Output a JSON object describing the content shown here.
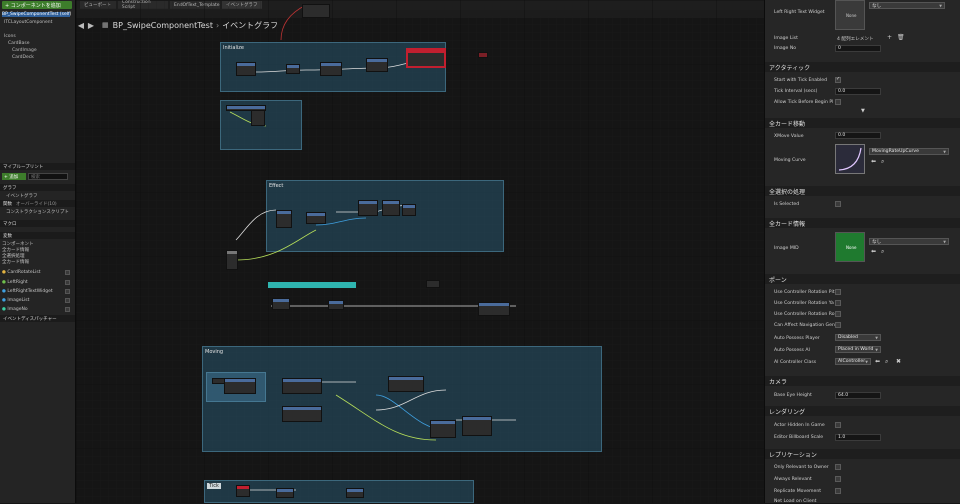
{
  "left_panel": {
    "add_component_button": "+ コンポーネントを追加",
    "components": [
      {
        "label": "BP_SwipeComponentTest (self)",
        "selected": true
      },
      {
        "label": "ITCLayoutComponent",
        "selected": false
      },
      {
        "label": "Icons",
        "selected": false
      },
      {
        "label": "CardBase",
        "selected": false
      },
      {
        "label": "CardImage",
        "selected": false
      },
      {
        "label": "CardDeck",
        "selected": false
      }
    ],
    "my_blueprint_title": "マイブループリント",
    "add_button": "+ 追加",
    "search_placeholder": "検索",
    "sections": [
      {
        "label": "グラフ"
      },
      {
        "label": "関数"
      },
      {
        "label": "マクロ"
      },
      {
        "label": "変数"
      }
    ],
    "graph_items": [
      "イベントグラフ"
    ],
    "function_items": [
      "オーバーライド(10)",
      "コンストラクションスクリプト"
    ],
    "variable_groups": [
      "コンポーネント",
      "全カード情報",
      "全選択処理",
      "全カード情報"
    ],
    "variables": [
      "CardRotateList",
      "LeftRight",
      "LeftRightTextWidget",
      "ImageList",
      "ImageNo"
    ],
    "dispatchers": "イベントディスパッチャー"
  },
  "tabs": [
    {
      "label": "ビューポート"
    },
    {
      "label": "Construction Script"
    },
    {
      "label": "EndOfText_Template"
    },
    {
      "label": "イベントグラフ"
    }
  ],
  "breadcrumb": {
    "back": "◀",
    "forward": "▶",
    "blueprint": "BP_SwipeComponentTest",
    "separator": "›",
    "graph": "イベントグラフ"
  },
  "comments": [
    {
      "label": "Initialize"
    },
    {
      "label": "Effect"
    },
    {
      "label": "Moving"
    },
    {
      "label": "Tick"
    }
  ],
  "details": {
    "top_rows": [
      {
        "label": "Left Right Text Widget",
        "value": "なし"
      },
      {
        "label": "Image List",
        "value": "4 配列エレメント"
      },
      {
        "label": "Image No",
        "value": "0"
      }
    ],
    "thumb_none": "None",
    "sections": [
      {
        "label": "アクタティック"
      },
      {
        "label": "全カード移動"
      },
      {
        "label": "全選択の処理"
      },
      {
        "label": "全カード情報"
      },
      {
        "label": "ポーン"
      },
      {
        "label": "カメラ"
      },
      {
        "label": "レンダリング"
      },
      {
        "label": "レプリケーション"
      }
    ],
    "tick": [
      {
        "label": "Start with Tick Enabled",
        "checked": true
      },
      {
        "label": "Tick Interval (secs)",
        "value": "0.0"
      },
      {
        "label": "Allow Tick Before Begin Pl",
        "checked": false
      }
    ],
    "card_move": [
      {
        "label": "XMove Value",
        "value": "0.0"
      },
      {
        "label": "Moving Curve",
        "value": "MovingRateUpCurve"
      }
    ],
    "selection": [
      {
        "label": "Is Selected",
        "checked": false
      }
    ],
    "card_info": [
      {
        "label": "Image MID",
        "value": "なし"
      }
    ],
    "pawn": [
      {
        "label": "Use Controller Rotation Pit",
        "checked": false
      },
      {
        "label": "Use Controller Rotation Ya",
        "checked": false
      },
      {
        "label": "Use Controller Rotation Ro",
        "checked": false
      },
      {
        "label": "Can Affect Navigation Gen",
        "checked": false
      },
      {
        "label": "Auto Possess Player",
        "value": "Disabled"
      },
      {
        "label": "Auto Possess AI",
        "value": "Placed in World"
      },
      {
        "label": "AI Controller Class",
        "value": "AIController"
      }
    ],
    "camera": [
      {
        "label": "Base Eye Height",
        "value": "64.0"
      }
    ],
    "rendering": [
      {
        "label": "Actor Hidden In Game",
        "checked": false
      },
      {
        "label": "Editor Billboard Scale",
        "value": "1.0"
      }
    ],
    "replication": [
      {
        "label": "Only Relevant to Owner",
        "checked": false
      },
      {
        "label": "Always Relevant",
        "checked": false
      },
      {
        "label": "Replicate Movement",
        "checked": false
      },
      {
        "label": "Net Load on Client",
        "checked": false
      }
    ]
  },
  "colors": {
    "accent_green": "#3d7d2b",
    "comment_blue": "#285a70",
    "node_header_red": "#c21f2f",
    "teal_bar": "#2fb5b0"
  }
}
